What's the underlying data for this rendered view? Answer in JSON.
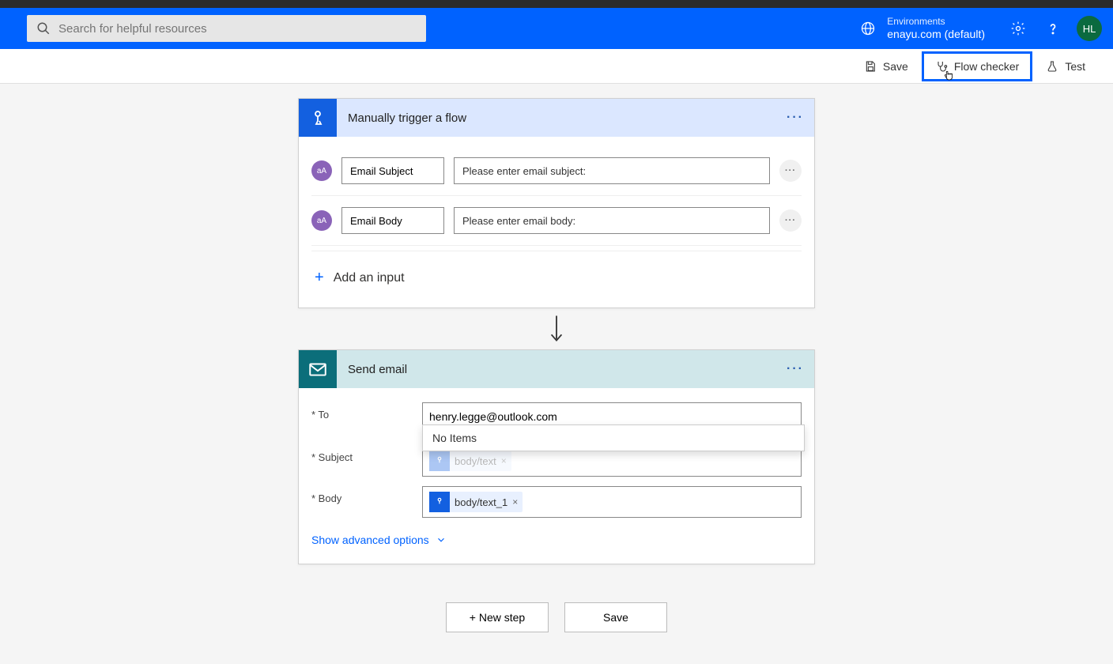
{
  "header": {
    "search_placeholder": "Search for helpful resources",
    "env_label": "Environments",
    "env_value": "enayu.com (default)",
    "avatar_initials": "HL"
  },
  "toolbar": {
    "save_label": "Save",
    "flow_checker_label": "Flow checker",
    "test_label": "Test"
  },
  "trigger": {
    "title": "Manually trigger a flow",
    "inputs": [
      {
        "name": "Email Subject",
        "prompt": "Please enter email subject:"
      },
      {
        "name": "Email Body",
        "prompt": "Please enter email body:"
      }
    ],
    "add_input_label": "Add an input"
  },
  "action": {
    "title": "Send email",
    "to_label": "* To",
    "to_value": "henry.legge@outlook.com",
    "to_dropdown": "No Items",
    "subject_label": "* Subject",
    "subject_token": "body/text",
    "body_label": "* Body",
    "body_token": "body/text_1",
    "advanced_label": "Show advanced options"
  },
  "bottom": {
    "new_step_label": "+ New step",
    "save_label": "Save"
  }
}
